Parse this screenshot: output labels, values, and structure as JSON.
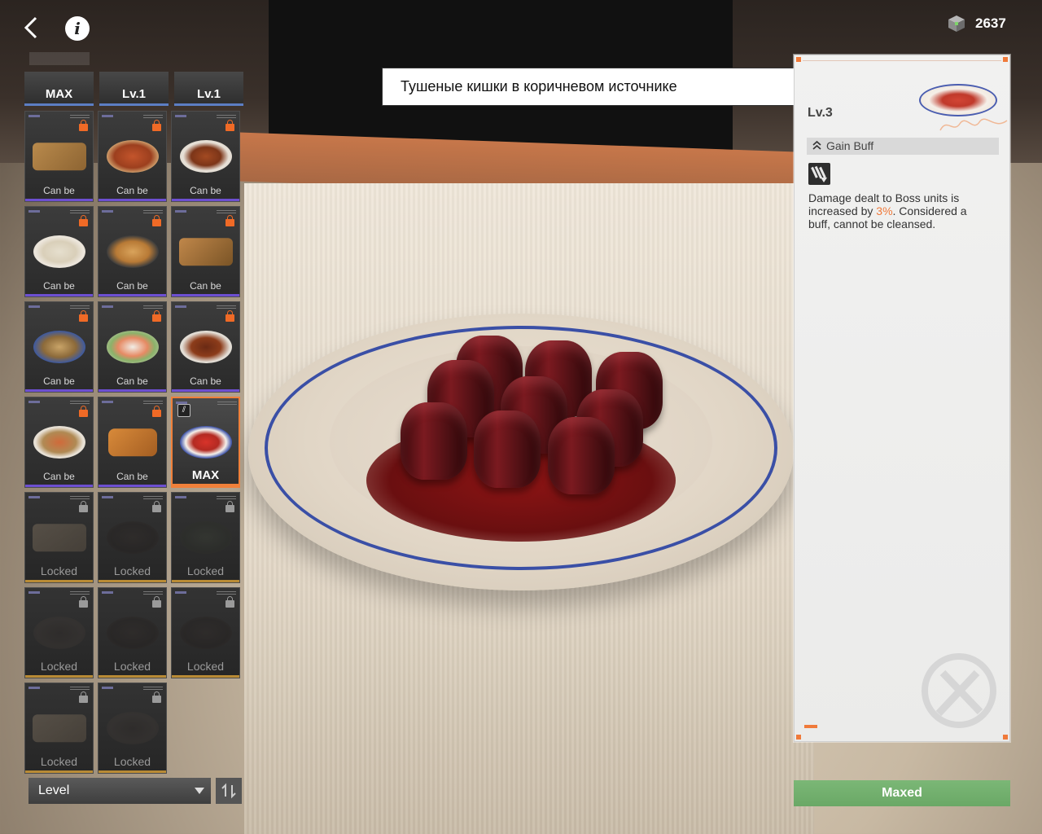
{
  "currency": {
    "icon": "cube-icon",
    "value": "2637"
  },
  "top_tabs": [
    {
      "label": "MAX"
    },
    {
      "label": "Lv.1"
    },
    {
      "label": "Lv.1"
    }
  ],
  "cards": [
    {
      "label": "Can be",
      "state": "available",
      "lock": "orange",
      "dish": "board"
    },
    {
      "label": "Can be",
      "state": "available",
      "lock": "orange",
      "dish": "soup"
    },
    {
      "label": "Can be",
      "state": "available",
      "lock": "orange",
      "dish": "balls"
    },
    {
      "label": "Can be",
      "state": "available",
      "lock": "orange",
      "dish": "dumplings"
    },
    {
      "label": "Can be",
      "state": "available",
      "lock": "orange",
      "dish": "buns"
    },
    {
      "label": "Can be",
      "state": "available",
      "lock": "orange",
      "dish": "burger"
    },
    {
      "label": "Can be",
      "state": "available",
      "lock": "orange",
      "dish": "tin"
    },
    {
      "label": "Can be",
      "state": "available",
      "lock": "orange",
      "dish": "sushi"
    },
    {
      "label": "Can be",
      "state": "available",
      "lock": "orange",
      "dish": "stirfry"
    },
    {
      "label": "Can be",
      "state": "available",
      "lock": "orange",
      "dish": "skewers"
    },
    {
      "label": "Can be",
      "state": "available",
      "lock": "orange",
      "dish": "roast"
    },
    {
      "label": "MAX",
      "state": "selected",
      "lock": "none",
      "dish": "intestines"
    },
    {
      "label": "Locked",
      "state": "locked",
      "lock": "grey",
      "dish": "board"
    },
    {
      "label": "Locked",
      "state": "locked",
      "lock": "grey",
      "dish": "bowl"
    },
    {
      "label": "Locked",
      "state": "locked",
      "lock": "grey",
      "dish": "greens"
    },
    {
      "label": "Locked",
      "state": "locked",
      "lock": "grey",
      "dish": "plate"
    },
    {
      "label": "Locked",
      "state": "locked",
      "lock": "grey",
      "dish": "bowl"
    },
    {
      "label": "Locked",
      "state": "locked",
      "lock": "grey",
      "dish": "bowl"
    },
    {
      "label": "Locked",
      "state": "locked",
      "lock": "grey",
      "dish": "board"
    },
    {
      "label": "Locked",
      "state": "locked",
      "lock": "grey",
      "dish": "plate"
    }
  ],
  "sort": {
    "label": "Level"
  },
  "dish_name": "Тушеные кишки в коричневом источнике",
  "info": {
    "level": "Lv.3",
    "buff_title": "Gain Buff",
    "desc_before": "Damage dealt to Boss units is increased by ",
    "desc_highlight": "3%",
    "desc_after": ". Considered a buff, cannot be cleansed."
  },
  "action_button": "Maxed",
  "colors": {
    "accent": "#f07a3a",
    "maxed": "#6faa6a",
    "tab_underline": "#5c7ec4",
    "purple_rarity": "#6d4fd1",
    "gold_rarity": "#b98b35"
  }
}
